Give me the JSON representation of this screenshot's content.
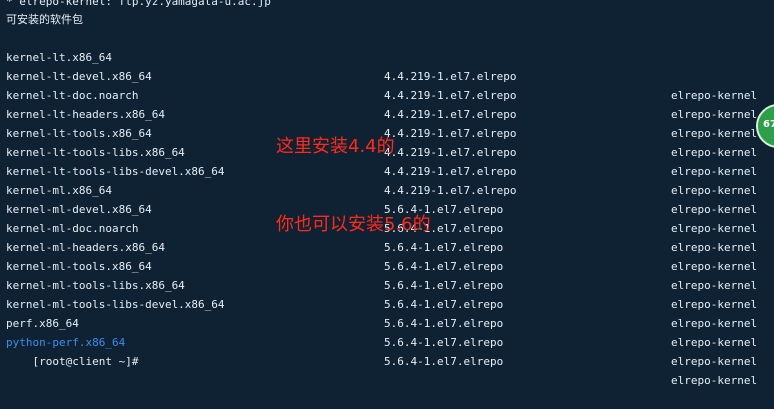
{
  "terminal": {
    "header_line": "* elrepo-kernel: ftp.yz.yamagata-u.ac.jp",
    "section_title": "可安装的软件包",
    "packages": [
      {
        "name": "kernel-lt.x86_64",
        "version": "4.4.219-1.el7.elrepo",
        "repo": "elrepo-kernel"
      },
      {
        "name": "kernel-lt-devel.x86_64",
        "version": "4.4.219-1.el7.elrepo",
        "repo": "elrepo-kernel"
      },
      {
        "name": "kernel-lt-doc.noarch",
        "version": "4.4.219-1.el7.elrepo",
        "repo": "elrepo-kernel"
      },
      {
        "name": "kernel-lt-headers.x86_64",
        "version": "4.4.219-1.el7.elrepo",
        "repo": "elrepo-kernel"
      },
      {
        "name": "kernel-lt-tools.x86_64",
        "version": "4.4.219-1.el7.elrepo",
        "repo": "elrepo-kernel"
      },
      {
        "name": "kernel-lt-tools-libs.x86_64",
        "version": "4.4.219-1.el7.elrepo",
        "repo": "elrepo-kernel"
      },
      {
        "name": "kernel-lt-tools-libs-devel.x86_64",
        "version": "4.4.219-1.el7.elrepo",
        "repo": "elrepo-kernel"
      },
      {
        "name": "kernel-ml.x86_64",
        "version": "5.6.4-1.el7.elrepo",
        "repo": "elrepo-kernel"
      },
      {
        "name": "kernel-ml-devel.x86_64",
        "version": "5.6.4-1.el7.elrepo",
        "repo": "elrepo-kernel"
      },
      {
        "name": "kernel-ml-doc.noarch",
        "version": "5.6.4-1.el7.elrepo",
        "repo": "elrepo-kernel"
      },
      {
        "name": "kernel-ml-headers.x86_64",
        "version": "5.6.4-1.el7.elrepo",
        "repo": "elrepo-kernel"
      },
      {
        "name": "kernel-ml-tools.x86_64",
        "version": "5.6.4-1.el7.elrepo",
        "repo": "elrepo-kernel"
      },
      {
        "name": "kernel-ml-tools-libs.x86_64",
        "version": "5.6.4-1.el7.elrepo",
        "repo": "elrepo-kernel"
      },
      {
        "name": "kernel-ml-tools-libs-devel.x86_64",
        "version": "5.6.4-1.el7.elrepo",
        "repo": "elrepo-kernel"
      },
      {
        "name": "perf.x86_64",
        "version": "5.6.4-1.el7.elrepo",
        "repo": "elrepo-kernel"
      },
      {
        "name": "python-perf.x86_64",
        "version": "5.6.4-1.el7.elrepo",
        "repo": "elrepo-kernel"
      }
    ],
    "prompt": "[root@client ~]#"
  },
  "annotation": {
    "line1": "这里安装4.4的",
    "line2": "你也可以安装5.6的"
  },
  "badge": {
    "text": "67"
  },
  "colors": {
    "background": "#0f2233",
    "text": "#e6eef6",
    "highlight_blue": "#3b8eea",
    "annotation_red": "#ff2a1a",
    "badge_green": "#2f9e4a"
  }
}
